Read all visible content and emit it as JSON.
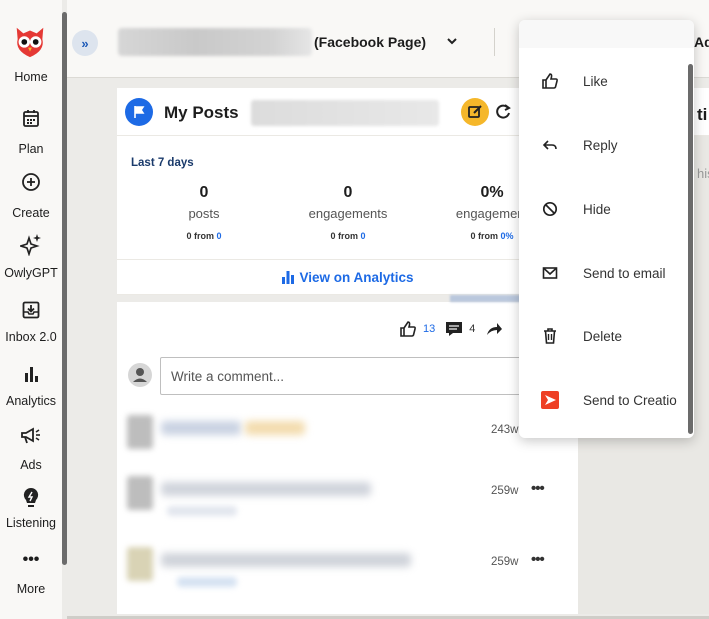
{
  "nav": {
    "items": [
      {
        "label": "Home",
        "icon": "owl-logo"
      },
      {
        "label": "Plan",
        "icon": "calendar-icon"
      },
      {
        "label": "Create",
        "icon": "plus-circle-icon"
      },
      {
        "label": "OwlyGPT",
        "icon": "sparkle-icon"
      },
      {
        "label": "Inbox 2.0",
        "icon": "inbox-icon"
      },
      {
        "label": "Analytics",
        "icon": "bar-chart-icon"
      },
      {
        "label": "Ads",
        "icon": "megaphone-icon"
      },
      {
        "label": "Listening",
        "icon": "lightbulb-icon"
      },
      {
        "label": "More",
        "icon": "more-dots-icon"
      }
    ]
  },
  "topbar": {
    "collapse_label": "»",
    "account_type": "(Facebook Page)",
    "right_fragment": "Ad"
  },
  "card": {
    "title": "My Posts",
    "period": "Last 7 days",
    "stats": [
      {
        "value": "0",
        "name": "posts",
        "from_prefix": "0 from ",
        "from_value": "0"
      },
      {
        "value": "0",
        "name": "engagements",
        "from_prefix": "0 from ",
        "from_value": "0"
      },
      {
        "value": "0%",
        "name": "engagement",
        "from_prefix": "0 from ",
        "from_value": "0%"
      }
    ],
    "analytics_link": "View on Analytics",
    "likes_count": "13",
    "comments_count": "4",
    "comment_placeholder": "Write a comment...",
    "comments": [
      {
        "time": "243w",
        "more": ""
      },
      {
        "time": "259w",
        "more": "•••"
      },
      {
        "time": "259w",
        "more": "•••"
      }
    ]
  },
  "right_column": {
    "title_fragment": "ti",
    "text_fragment": "his"
  },
  "menu": {
    "items": [
      {
        "label": "Like",
        "icon": "thumbs-up-icon"
      },
      {
        "label": "Reply",
        "icon": "reply-arrow-icon"
      },
      {
        "label": "Hide",
        "icon": "hide-circle-icon"
      },
      {
        "label": "Send to email",
        "icon": "envelope-icon"
      },
      {
        "label": "Delete",
        "icon": "trash-icon"
      },
      {
        "label": "Send to Creatio",
        "icon": "creatio-logo-icon"
      }
    ]
  },
  "colors": {
    "brand_red": "#e53935",
    "accent_blue": "#1d6ae5",
    "compose_yellow": "#f5b72a",
    "creatio_red": "#ee3f24"
  }
}
